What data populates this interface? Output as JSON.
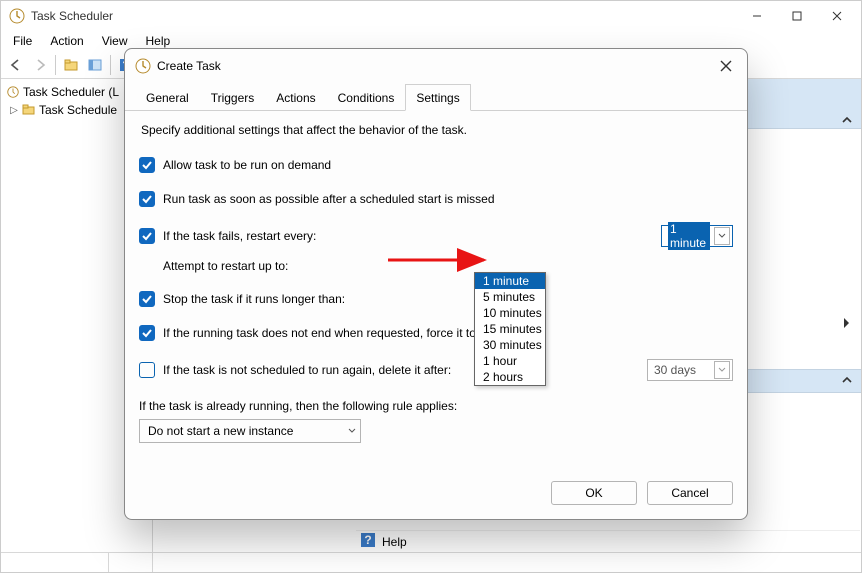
{
  "window": {
    "title": "Task Scheduler",
    "menus": {
      "file": "File",
      "action": "Action",
      "view": "View",
      "help": "Help"
    }
  },
  "tree": {
    "root": "Task Scheduler (L",
    "child": "Task Schedule"
  },
  "help": {
    "label": "Help"
  },
  "dialog": {
    "title": "Create Task",
    "tabs": {
      "general": "General",
      "triggers": "Triggers",
      "actions": "Actions",
      "conditions": "Conditions",
      "settings": "Settings"
    },
    "description": "Specify additional settings that affect the behavior of the task.",
    "opts": {
      "allow_demand": "Allow task to be run on demand",
      "run_asap": "Run task as soon as possible after a scheduled start is missed",
      "restart_every": "If the task fails, restart every:",
      "attempt_upto": "Attempt to restart up to:",
      "stop_longer": "Stop the task if it runs longer than:",
      "force_stop": "If the running task does not end when requested, force it to st",
      "delete_after": "If the task is not scheduled to run again, delete it after:",
      "already_running": "If the task is already running, then the following rule applies:"
    },
    "restart_value": "1 minute",
    "restart_options": [
      "1 minute",
      "5 minutes",
      "10 minutes",
      "15 minutes",
      "30 minutes",
      "1 hour",
      "2 hours"
    ],
    "delete_after_value": "30 days",
    "rule_value": "Do not start a new instance",
    "buttons": {
      "ok": "OK",
      "cancel": "Cancel"
    }
  }
}
